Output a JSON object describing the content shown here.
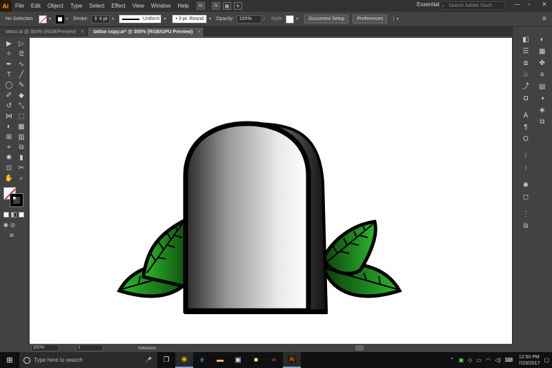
{
  "app": {
    "logo": "Ai",
    "accent": "#ff9a00"
  },
  "menu": {
    "items": [
      "File",
      "Edit",
      "Object",
      "Type",
      "Select",
      "Effect",
      "View",
      "Window",
      "Help"
    ],
    "bridge": "Br",
    "stock": "St",
    "workspace": "Essentials",
    "search_placeholder": "Search Adobe Stock"
  },
  "control": {
    "selection_label": "No Selection",
    "stroke_label": "Stroke:",
    "stroke_weight": "4 pt",
    "profile": "Uniform",
    "brush": "3 pt. Round",
    "opacity_label": "Opacity:",
    "opacity_value": "100%",
    "style_label": "Style:",
    "document_setup": "Document Setup",
    "preferences": "Preferences"
  },
  "tabs": [
    {
      "label": "tattoo.ai @ 300% (RGB/Preview)",
      "active": false
    },
    {
      "label": "tattoo copy.ai* @ 300% (RGB/GPU Preview)",
      "active": true
    }
  ],
  "status": {
    "zoom": "300%",
    "page": "1",
    "tool": "Selection"
  },
  "taskbar": {
    "search_placeholder": "Type here to search",
    "time": "12:50 PM",
    "date": "7/23/2017",
    "apps": [
      "task-view-icon",
      "chrome-icon",
      "edge-icon",
      "file-explorer-icon",
      "store-icon",
      "sticky-notes-icon",
      "creative-cloud-icon",
      "illustrator-icon"
    ]
  },
  "artwork": {
    "leaf_color": "#2db82d",
    "outline_color": "#000000",
    "gradient_dark": "#2a2a2a",
    "gradient_light": "#ffffff"
  }
}
